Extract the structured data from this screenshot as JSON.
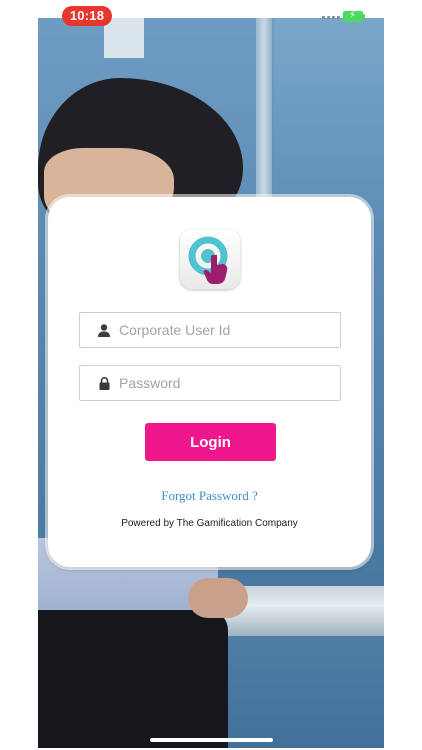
{
  "status_bar": {
    "time": "10:18"
  },
  "login_card": {
    "user_id_placeholder": "Corporate User Id",
    "password_placeholder": "Password",
    "login_label": "Login",
    "forgot_password_label": "Forgot Password ?",
    "powered_by": "Powered by The Gamification Company"
  },
  "icons": {
    "user": "user-icon",
    "lock": "lock-icon",
    "app_logo": "app-logo-icon"
  },
  "colors": {
    "time_pill": "#e8362f",
    "login_button": "#f0168c",
    "forgot_link": "#3a8fc7",
    "logo_ring": "#4fc3cf",
    "logo_hand": "#9c1f6e",
    "battery": "#4cd964"
  }
}
